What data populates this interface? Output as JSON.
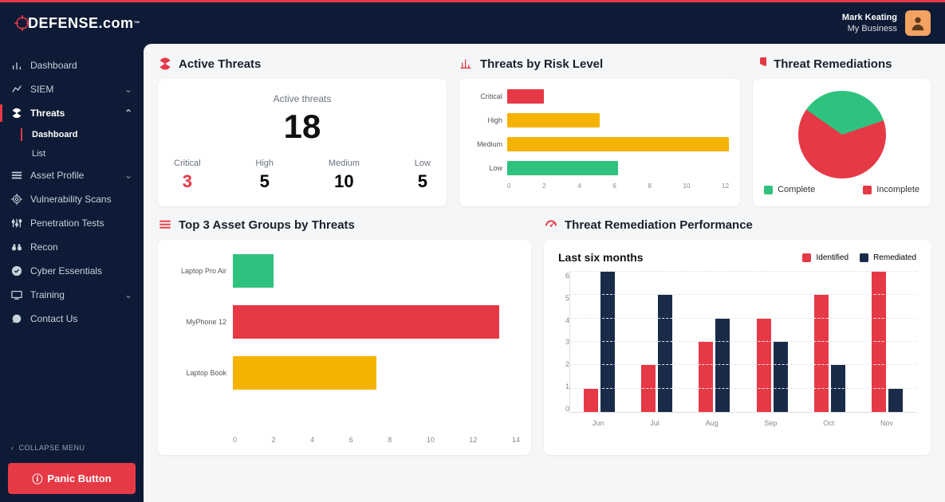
{
  "brand": {
    "name_pre": "DEFENSE",
    "name_suf": ".com",
    "tm": "™"
  },
  "user": {
    "name": "Mark Keating",
    "business": "My Business"
  },
  "sidebar": {
    "items": [
      {
        "label": "Dashboard",
        "icon": "bar"
      },
      {
        "label": "SIEM",
        "icon": "chart",
        "expandable": true,
        "expanded": false
      },
      {
        "label": "Threats",
        "icon": "radiation",
        "expandable": true,
        "expanded": true,
        "active": true,
        "sub": [
          {
            "label": "Dashboard",
            "active": true
          },
          {
            "label": "List"
          }
        ]
      },
      {
        "label": "Asset Profile",
        "icon": "list",
        "expandable": true,
        "expanded": false
      },
      {
        "label": "Vulnerability Scans",
        "icon": "target"
      },
      {
        "label": "Penetration Tests",
        "icon": "sliders"
      },
      {
        "label": "Recon",
        "icon": "binoculars"
      },
      {
        "label": "Cyber Essentials",
        "icon": "check"
      },
      {
        "label": "Training",
        "icon": "screen",
        "expandable": true,
        "expanded": false
      },
      {
        "label": "Contact Us",
        "icon": "chat"
      }
    ],
    "collapse_label": "COLLAPSE MENU",
    "panic_label": "Panic Button"
  },
  "cards": {
    "active_threats": {
      "title": "Active Threats",
      "subtitle": "Active threats",
      "total": "18",
      "breakdown": [
        {
          "label": "Critical",
          "value": "3",
          "cls": "val-critical"
        },
        {
          "label": "High",
          "value": "5"
        },
        {
          "label": "Medium",
          "value": "10"
        },
        {
          "label": "Low",
          "value": "5"
        }
      ]
    },
    "risk_level": {
      "title": "Threats by Risk Level"
    },
    "remediations": {
      "title": "Threat Remediations",
      "legend": [
        {
          "label": "Complete",
          "color": "#2ec27e"
        },
        {
          "label": "Incomplete",
          "color": "#e63946"
        }
      ]
    },
    "asset_groups": {
      "title": "Top 3 Asset Groups by Threats"
    },
    "performance": {
      "title": "Threat Remediation Performance",
      "subtitle": "Last six months",
      "legend": [
        {
          "label": "Identified",
          "color": "#e63946"
        },
        {
          "label": "Remediated",
          "color": "#1a2b4a"
        }
      ]
    }
  },
  "chart_data": [
    {
      "id": "risk_level",
      "type": "bar",
      "orientation": "horizontal",
      "categories": [
        "Critical",
        "High",
        "Medium",
        "Low"
      ],
      "values": [
        2,
        5,
        12,
        6
      ],
      "colors": [
        "#e63946",
        "#f5b301",
        "#f5b301",
        "#2ec27e"
      ],
      "xlim": [
        0,
        12
      ],
      "xticks": [
        0,
        2,
        4,
        6,
        8,
        10,
        12
      ]
    },
    {
      "id": "remediations",
      "type": "pie",
      "series": [
        {
          "name": "Complete",
          "value": 35,
          "color": "#2ec27e"
        },
        {
          "name": "Incomplete",
          "value": 65,
          "color": "#e63946"
        }
      ]
    },
    {
      "id": "asset_groups",
      "type": "bar",
      "orientation": "horizontal",
      "categories": [
        "Laptop Pro Air",
        "MyPhone 12",
        "Laptop Book"
      ],
      "values": [
        2,
        13,
        7
      ],
      "colors": [
        "#2ec27e",
        "#e63946",
        "#f5b301"
      ],
      "xlim": [
        0,
        14
      ],
      "xticks": [
        0,
        2,
        4,
        6,
        8,
        10,
        12,
        14
      ]
    },
    {
      "id": "performance",
      "type": "bar",
      "categories": [
        "Jun",
        "Jul",
        "Aug",
        "Sep",
        "Oct",
        "Nov"
      ],
      "series": [
        {
          "name": "Identified",
          "color": "#e63946",
          "values": [
            1,
            2,
            3,
            4,
            5,
            6
          ]
        },
        {
          "name": "Remediated",
          "color": "#1a2b4a",
          "values": [
            6,
            5,
            4,
            3,
            2,
            1
          ]
        }
      ],
      "ylim": [
        0,
        6
      ],
      "yticks": [
        0,
        1,
        2,
        3,
        4,
        5,
        6
      ]
    }
  ]
}
